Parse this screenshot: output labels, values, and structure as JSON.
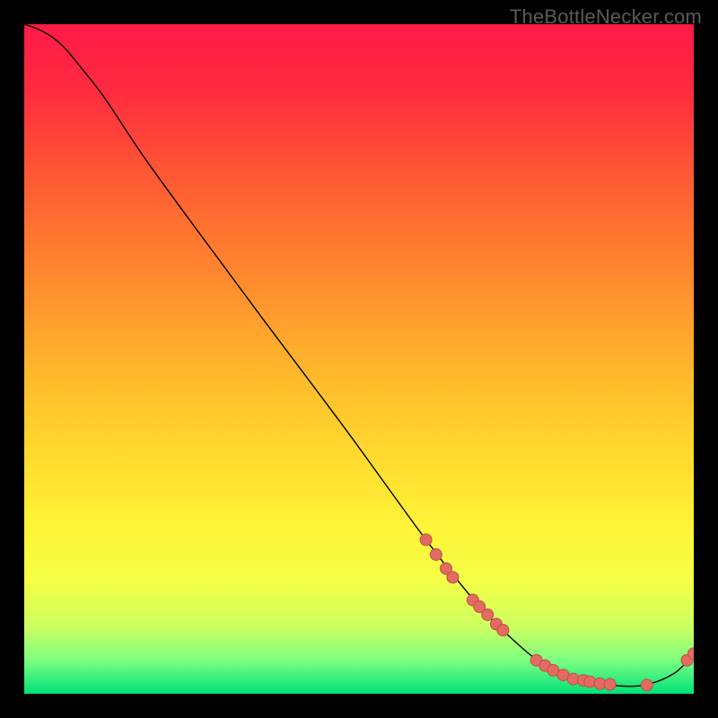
{
  "watermark": "TheBottleNecker.com",
  "chart_data": {
    "type": "line",
    "title": "",
    "xlabel": "",
    "ylabel": "",
    "xlim": [
      0,
      100
    ],
    "ylim": [
      0,
      100
    ],
    "gradient_stops": [
      {
        "offset": 0.0,
        "color": "#ff1a47"
      },
      {
        "offset": 0.1,
        "color": "#ff2b3f"
      },
      {
        "offset": 0.23,
        "color": "#ff5a33"
      },
      {
        "offset": 0.38,
        "color": "#ff8a2e"
      },
      {
        "offset": 0.52,
        "color": "#ffb82c"
      },
      {
        "offset": 0.64,
        "color": "#ffd92e"
      },
      {
        "offset": 0.75,
        "color": "#fff338"
      },
      {
        "offset": 0.83,
        "color": "#f4ff45"
      },
      {
        "offset": 0.9,
        "color": "#ccff60"
      },
      {
        "offset": 0.95,
        "color": "#7cff80"
      },
      {
        "offset": 1.0,
        "color": "#00e17a"
      }
    ],
    "series": [
      {
        "name": "bottleneck-curve",
        "stroke": "#000000",
        "stroke_width": 1.4,
        "x": [
          0.0,
          2.0,
          4.0,
          6.0,
          8.5,
          12.0,
          18.0,
          26.0,
          36.0,
          48.0,
          60.0,
          68.0,
          72.0,
          76.0,
          80.0,
          86.0,
          92.0,
          97.0,
          100.0
        ],
        "y": [
          100.0,
          99.3,
          98.2,
          96.5,
          93.5,
          89.0,
          80.0,
          69.0,
          55.5,
          39.5,
          23.0,
          13.0,
          9.0,
          5.5,
          3.0,
          1.5,
          1.2,
          3.0,
          6.0
        ]
      }
    ],
    "points": {
      "name": "highlight-points",
      "fill": "#e36b61",
      "stroke": "#bd5149",
      "radius": 6.5,
      "data": [
        {
          "x": 60.0,
          "y": 23.0
        },
        {
          "x": 61.5,
          "y": 20.8
        },
        {
          "x": 63.0,
          "y": 18.7
        },
        {
          "x": 64.0,
          "y": 17.4
        },
        {
          "x": 67.0,
          "y": 14.0
        },
        {
          "x": 68.0,
          "y": 13.0
        },
        {
          "x": 69.2,
          "y": 11.8
        },
        {
          "x": 70.5,
          "y": 10.4
        },
        {
          "x": 71.5,
          "y": 9.5
        },
        {
          "x": 76.5,
          "y": 5.0
        },
        {
          "x": 77.8,
          "y": 4.2
        },
        {
          "x": 79.0,
          "y": 3.5
        },
        {
          "x": 80.5,
          "y": 2.8
        },
        {
          "x": 82.0,
          "y": 2.2
        },
        {
          "x": 83.5,
          "y": 2.0
        },
        {
          "x": 84.5,
          "y": 1.8
        },
        {
          "x": 86.0,
          "y": 1.5
        },
        {
          "x": 87.5,
          "y": 1.4
        },
        {
          "x": 93.0,
          "y": 1.3
        },
        {
          "x": 99.0,
          "y": 5.0
        },
        {
          "x": 100.0,
          "y": 6.0
        }
      ]
    }
  }
}
